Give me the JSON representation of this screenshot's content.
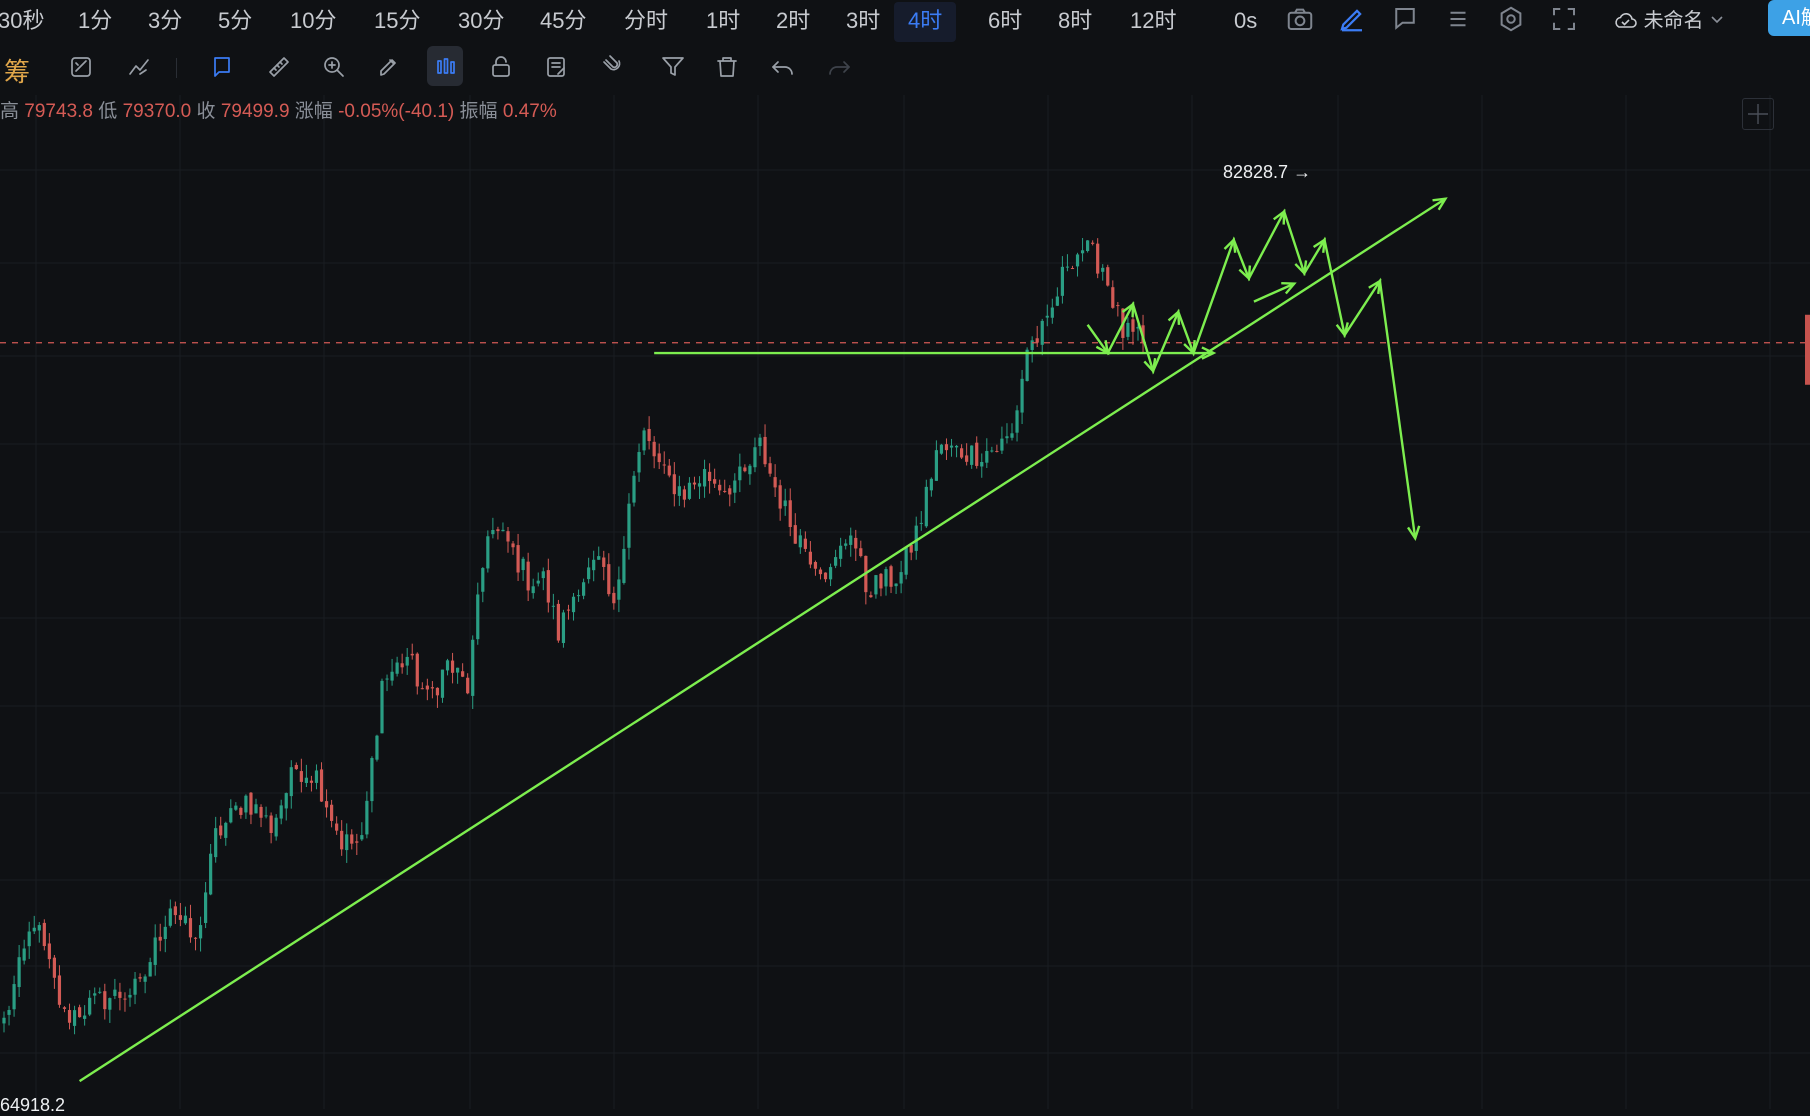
{
  "timeframes": [
    {
      "label": "30秒",
      "active": false
    },
    {
      "label": "1分",
      "active": false
    },
    {
      "label": "3分",
      "active": false
    },
    {
      "label": "5分",
      "active": false
    },
    {
      "label": "10分",
      "active": false
    },
    {
      "label": "15分",
      "active": false
    },
    {
      "label": "30分",
      "active": false
    },
    {
      "label": "45分",
      "active": false
    },
    {
      "label": "分时",
      "active": false
    },
    {
      "label": "1时",
      "active": false
    },
    {
      "label": "2时",
      "active": false
    },
    {
      "label": "3时",
      "active": false
    },
    {
      "label": "4时",
      "active": true
    },
    {
      "label": "6时",
      "active": false
    },
    {
      "label": "8时",
      "active": false
    },
    {
      "label": "12时",
      "active": false
    },
    {
      "label": "0s",
      "active": false
    }
  ],
  "header": {
    "layout_name": "未命名",
    "ai_button": "AI解"
  },
  "toolbar": {
    "chips_label": "筹",
    "tools": [
      "indicator-icon",
      "compare-icon",
      "cursor-icon",
      "ruler-icon",
      "zoom-icon",
      "brush-icon",
      "bars-icon",
      "lock-icon",
      "notes-icon",
      "magnet-icon",
      "filter-icon",
      "trash-icon",
      "undo-icon",
      "redo-icon"
    ]
  },
  "ohlc": {
    "high_label": "高",
    "high": "79743.8",
    "low_label": "低",
    "low": "79370.0",
    "close_label": "收",
    "close": "79499.9",
    "change_label": "涨幅",
    "change": "-0.05%(-40.1)",
    "amplitude_label": "振幅",
    "amplitude": "0.47%"
  },
  "colors": {
    "up": "#2a9e84",
    "down": "#d35a55",
    "drawing": "#7dee4f",
    "price_line": "#d35a55",
    "active_tab": "#3b7cf5"
  },
  "chart_data": {
    "type": "candlestick",
    "timeframe": "4时",
    "ylim": [
      64918.2,
      82828.7
    ],
    "annotations": {
      "max_price": "82828.7",
      "min_price": "64918.2"
    },
    "current_price": 79499.9,
    "close_path": [
      {
        "i": 0,
        "y": 66300
      },
      {
        "i": 6,
        "y": 68300
      },
      {
        "i": 12,
        "y": 66400
      },
      {
        "i": 20,
        "y": 66750
      },
      {
        "i": 27,
        "y": 66950
      },
      {
        "i": 33,
        "y": 68600
      },
      {
        "i": 38,
        "y": 67800
      },
      {
        "i": 42,
        "y": 69900
      },
      {
        "i": 48,
        "y": 70650
      },
      {
        "i": 53,
        "y": 70100
      },
      {
        "i": 58,
        "y": 71250
      },
      {
        "i": 62,
        "y": 71100
      },
      {
        "i": 67,
        "y": 69800
      },
      {
        "i": 71,
        "y": 69750
      },
      {
        "i": 75,
        "y": 72900
      },
      {
        "i": 80,
        "y": 73400
      },
      {
        "i": 84,
        "y": 72550
      },
      {
        "i": 88,
        "y": 73250
      },
      {
        "i": 92,
        "y": 72800
      },
      {
        "i": 96,
        "y": 75900
      },
      {
        "i": 100,
        "y": 75600
      },
      {
        "i": 104,
        "y": 74900
      },
      {
        "i": 107,
        "y": 74900
      },
      {
        "i": 110,
        "y": 73850
      },
      {
        "i": 114,
        "y": 74850
      },
      {
        "i": 118,
        "y": 75200
      },
      {
        "i": 121,
        "y": 74250
      },
      {
        "i": 124,
        "y": 76500
      },
      {
        "i": 127,
        "y": 77700
      },
      {
        "i": 131,
        "y": 76900
      },
      {
        "i": 135,
        "y": 76600
      },
      {
        "i": 139,
        "y": 76950
      },
      {
        "i": 143,
        "y": 76700
      },
      {
        "i": 147,
        "y": 76900
      },
      {
        "i": 150,
        "y": 77500
      },
      {
        "i": 153,
        "y": 76700
      },
      {
        "i": 156,
        "y": 76000
      },
      {
        "i": 160,
        "y": 75400
      },
      {
        "i": 164,
        "y": 75000
      },
      {
        "i": 168,
        "y": 75900
      },
      {
        "i": 171,
        "y": 74750
      },
      {
        "i": 174,
        "y": 74800
      },
      {
        "i": 178,
        "y": 75000
      },
      {
        "i": 182,
        "y": 76100
      },
      {
        "i": 185,
        "y": 77400
      },
      {
        "i": 189,
        "y": 77400
      },
      {
        "i": 193,
        "y": 77350
      },
      {
        "i": 197,
        "y": 77450
      },
      {
        "i": 200,
        "y": 77700
      },
      {
        "i": 203,
        "y": 79400
      },
      {
        "i": 207,
        "y": 79800
      },
      {
        "i": 211,
        "y": 81100
      },
      {
        "i": 214,
        "y": 81350
      },
      {
        "i": 218,
        "y": 81000
      },
      {
        "i": 222,
        "y": 79700
      },
      {
        "i": 226,
        "y": 79500
      }
    ],
    "drawings": {
      "trendline": [
        {
          "i": 15,
          "y": 65150
        },
        {
          "i": 286,
          "y": 82300
        }
      ],
      "resistance": [
        {
          "i": 129,
          "y": 79300
        },
        {
          "i": 240,
          "y": 79300
        }
      ],
      "projection_a": [
        {
          "i": 215,
          "y": 79850
        },
        {
          "i": 219,
          "y": 79300
        },
        {
          "i": 224,
          "y": 80250
        },
        {
          "i": 228,
          "y": 78950
        },
        {
          "i": 233,
          "y": 80100
        },
        {
          "i": 236,
          "y": 79300
        },
        {
          "i": 244,
          "y": 81500
        },
        {
          "i": 247,
          "y": 80750
        },
        {
          "i": 254,
          "y": 82050
        },
        {
          "i": 258,
          "y": 80850
        },
        {
          "i": 262,
          "y": 81500
        },
        {
          "i": 266,
          "y": 79650
        },
        {
          "i": 273,
          "y": 80700
        },
        {
          "i": 280,
          "y": 75700
        }
      ],
      "projection_b": [
        {
          "i": 248,
          "y": 80300
        },
        {
          "i": 256,
          "y": 80650
        }
      ]
    }
  }
}
